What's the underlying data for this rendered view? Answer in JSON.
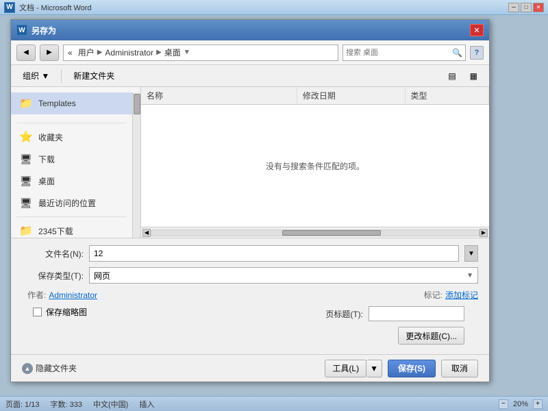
{
  "window": {
    "title": "文档 - Microsoft Word",
    "word_icon": "W"
  },
  "dialog": {
    "title": "另存为",
    "close_btn": "✕"
  },
  "address_bar": {
    "back_btn": "◀",
    "forward_btn": "▶",
    "path": [
      "«",
      "用户",
      "▶",
      "Administrator",
      "▶",
      "桌面"
    ],
    "search_placeholder": "搜索 桌面"
  },
  "toolbar": {
    "organize_label": "组织 ▼",
    "new_folder_label": "新建文件夹",
    "help_label": "?"
  },
  "sidebar": {
    "items": [
      {
        "label": "Templates",
        "icon": "📁",
        "selected": true
      },
      {
        "label": "收藏夹",
        "icon": "⭐",
        "section": true
      },
      {
        "label": "下载",
        "icon": "🖥"
      },
      {
        "label": "桌面",
        "icon": "🖥"
      },
      {
        "label": "最近访问的位置",
        "icon": "🖥"
      },
      {
        "label": "2345下载",
        "icon": "📁"
      }
    ]
  },
  "file_list": {
    "headers": [
      "名称",
      "修改日期",
      "类型"
    ],
    "empty_message": "没有与搜索条件匹配的项。"
  },
  "form": {
    "filename_label": "文件名(N):",
    "filename_value": "12",
    "filetype_label": "保存类型(T):",
    "filetype_value": "网页",
    "author_label": "作者:",
    "author_value": "Administrator",
    "tags_label": "标记:",
    "tags_value": "添加标记",
    "save_thumbnail_label": "保存缩略图",
    "page_title_label": "页标题(T):",
    "change_title_label": "更改标题(C)..."
  },
  "action_bar": {
    "hide_folders_label": "隐藏文件夹",
    "tools_label": "工具(L)",
    "save_label": "保存(S)",
    "cancel_label": "取消"
  },
  "status_bar": {
    "page": "页面: 1/13",
    "words": "字数: 333",
    "language": "中文(中国)",
    "mode": "插入",
    "zoom": "20%"
  }
}
